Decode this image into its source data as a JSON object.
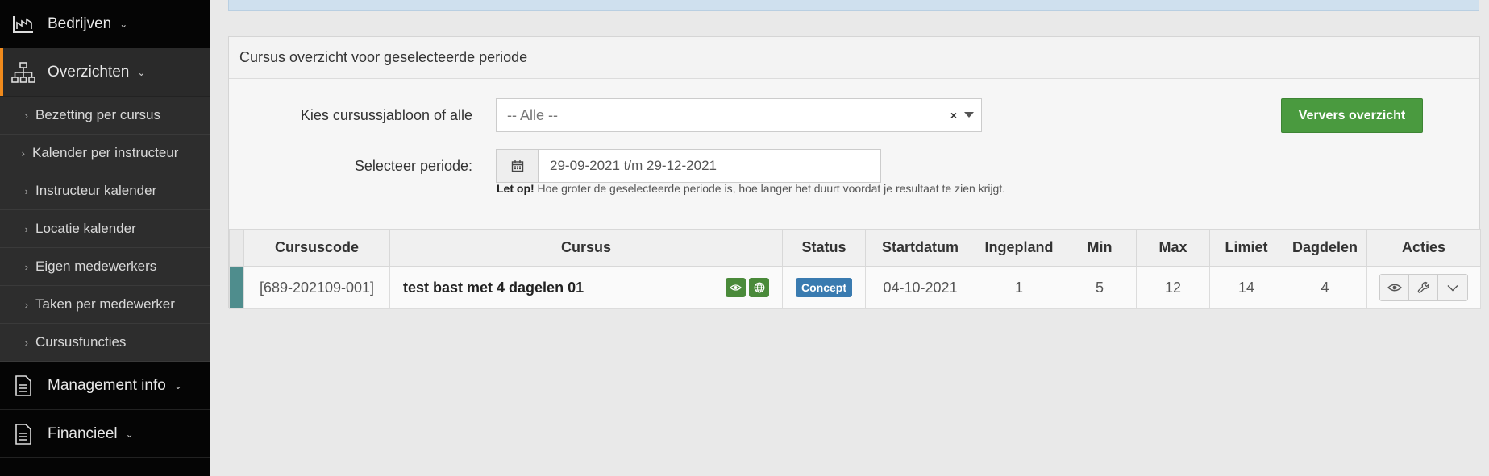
{
  "sidebar": {
    "items": [
      {
        "label": "Bedrijven",
        "icon": "chart-line-icon"
      },
      {
        "label": "Overzichten",
        "icon": "sitemap-icon"
      },
      {
        "label": "Management info",
        "icon": "document-icon"
      },
      {
        "label": "Financieel",
        "icon": "document-icon"
      }
    ],
    "subitems": [
      "Bezetting per cursus",
      "Kalender per instructeur",
      "Instructeur kalender",
      "Locatie kalender",
      "Eigen medewerkers",
      "Taken per medewerker",
      "Cursusfuncties"
    ],
    "accent_color": "#f08a1c"
  },
  "panel": {
    "title": "Cursus overzicht voor geselecteerde periode",
    "template_label": "Kies cursussjabloon of alle",
    "template_value": "-- Alle --",
    "refresh_button": "Ververs overzicht",
    "period_label": "Selecteer periode:",
    "period_value": "29-09-2021 t/m 29-12-2021",
    "note_bold": "Let op!",
    "note_text": " Hoe groter de geselecteerde periode is, hoe langer het duurt voordat je resultaat te zien krijgt."
  },
  "table": {
    "headers": [
      "Cursuscode",
      "Cursus",
      "Status",
      "Startdatum",
      "Ingepland",
      "Min",
      "Max",
      "Limiet",
      "Dagdelen",
      "Acties"
    ],
    "rows": [
      {
        "code": "[689-202109-001]",
        "course": "test bast met 4 dagelen 01",
        "status": "Concept",
        "start": "04-10-2021",
        "planned": "1",
        "min": "5",
        "max": "12",
        "limit": "14",
        "parts": "4"
      }
    ]
  },
  "colors": {
    "button_green": "#4a9a3f",
    "badge_blue": "#3a7bb0",
    "row_strip": "#4f8d8d"
  }
}
